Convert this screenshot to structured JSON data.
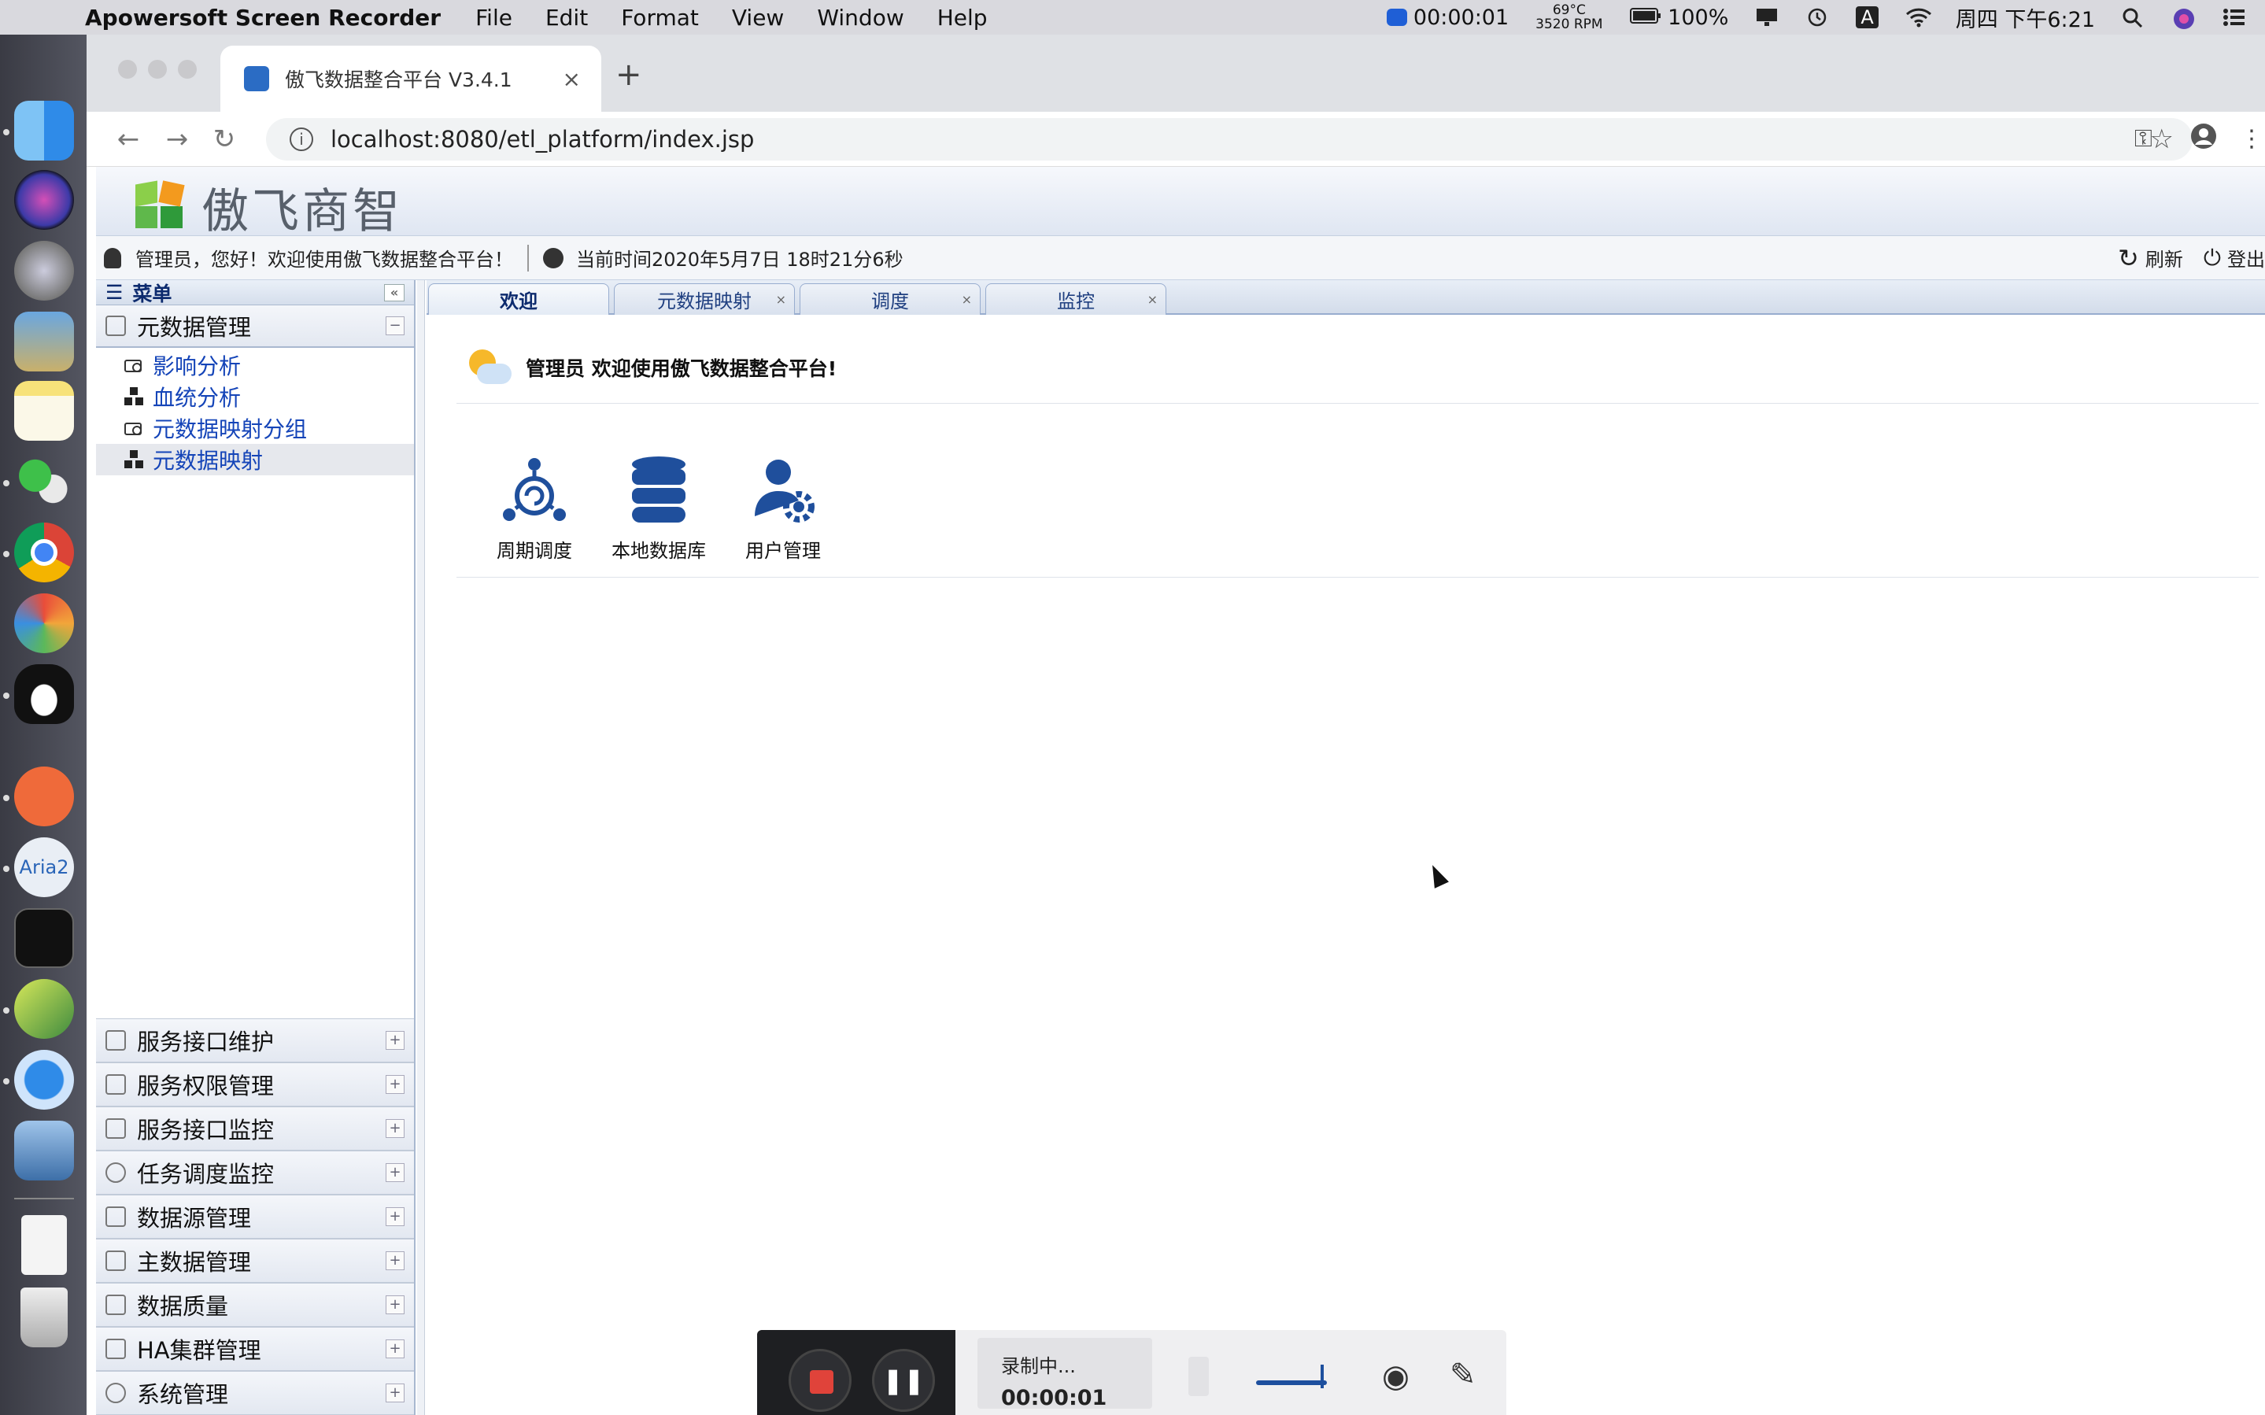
{
  "menubar": {
    "app_name": "Apowersoft Screen Recorder",
    "menus": [
      "File",
      "Edit",
      "Format",
      "View",
      "Window",
      "Help"
    ],
    "rec_timer": "00:00:01",
    "temp": "69°C",
    "rpm": "3520 RPM",
    "battery": "100%",
    "input_method": "A",
    "datetime": "周四 下午6:21"
  },
  "dock": {
    "aria2_label": "Aria2"
  },
  "browser": {
    "tab_title": "傲飞数据整合平台 V3.4.1",
    "tab_close": "×",
    "new_tab": "+",
    "url": "localhost:8080/etl_platform/index.jsp"
  },
  "header": {
    "logo_text": "傲飞商智",
    "greeting": "管理员，您好！欢迎使用傲飞数据整合平台！",
    "current_time": "当前时间2020年5月7日 18时21分6秒",
    "refresh_label": "刷新",
    "logout_label": "登出"
  },
  "sidebar": {
    "title": "菜单",
    "expanded_group": "元数据管理",
    "tree_items": [
      "影响分析",
      "血统分析",
      "元数据映射分组",
      "元数据映射"
    ],
    "selected_index": 3,
    "groups": [
      "服务接口维护",
      "服务权限管理",
      "服务接口监控",
      "任务调度监控",
      "数据源管理",
      "主数据管理",
      "数据质量",
      "HA集群管理",
      "系统管理"
    ]
  },
  "main": {
    "tabs": [
      {
        "label": "欢迎",
        "closable": false,
        "active": true
      },
      {
        "label": "元数据映射",
        "closable": true,
        "active": false
      },
      {
        "label": "调度",
        "closable": true,
        "active": false
      },
      {
        "label": "监控",
        "closable": true,
        "active": false
      }
    ],
    "welcome_text": "管理员 欢迎使用傲飞数据整合平台!",
    "quick_links": [
      "周期调度",
      "本地数据库",
      "用户管理"
    ]
  },
  "recorder": {
    "status": "录制中...",
    "time": "00:00:01"
  },
  "colors": {
    "tree_link": "#1444b8",
    "tab_text": "#1f3f80",
    "icon_blue": "#1f4f9c",
    "stop_red": "#e0433a"
  }
}
